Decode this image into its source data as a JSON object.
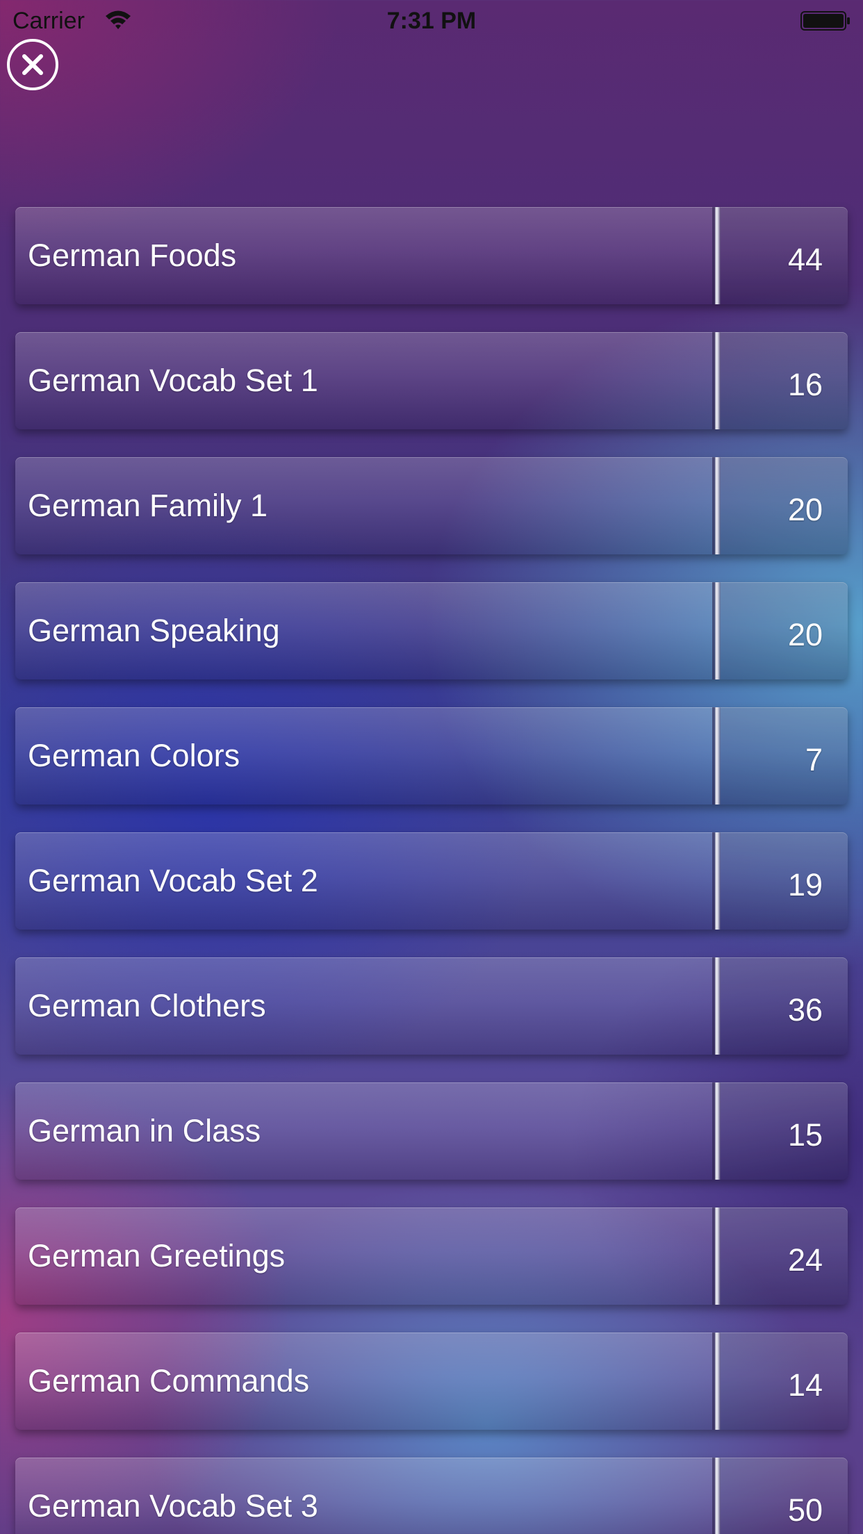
{
  "status_bar": {
    "carrier": "Carrier",
    "time": "7:31 PM",
    "wifi_icon": "wifi-icon",
    "battery_icon": "battery-icon"
  },
  "close_button": {
    "icon": "close-icon"
  },
  "decks": [
    {
      "title": "German Foods",
      "count": "44"
    },
    {
      "title": "German Vocab Set 1",
      "count": "16"
    },
    {
      "title": "German Family 1",
      "count": "20"
    },
    {
      "title": "German Speaking",
      "count": "20"
    },
    {
      "title": "German Colors",
      "count": "7"
    },
    {
      "title": "German Vocab Set 2",
      "count": "19"
    },
    {
      "title": "German Clothers",
      "count": "36"
    },
    {
      "title": "German in Class",
      "count": "15"
    },
    {
      "title": "German Greetings",
      "count": "24"
    },
    {
      "title": "German Commands",
      "count": "14"
    },
    {
      "title": "German Vocab Set 3",
      "count": "50"
    }
  ]
}
